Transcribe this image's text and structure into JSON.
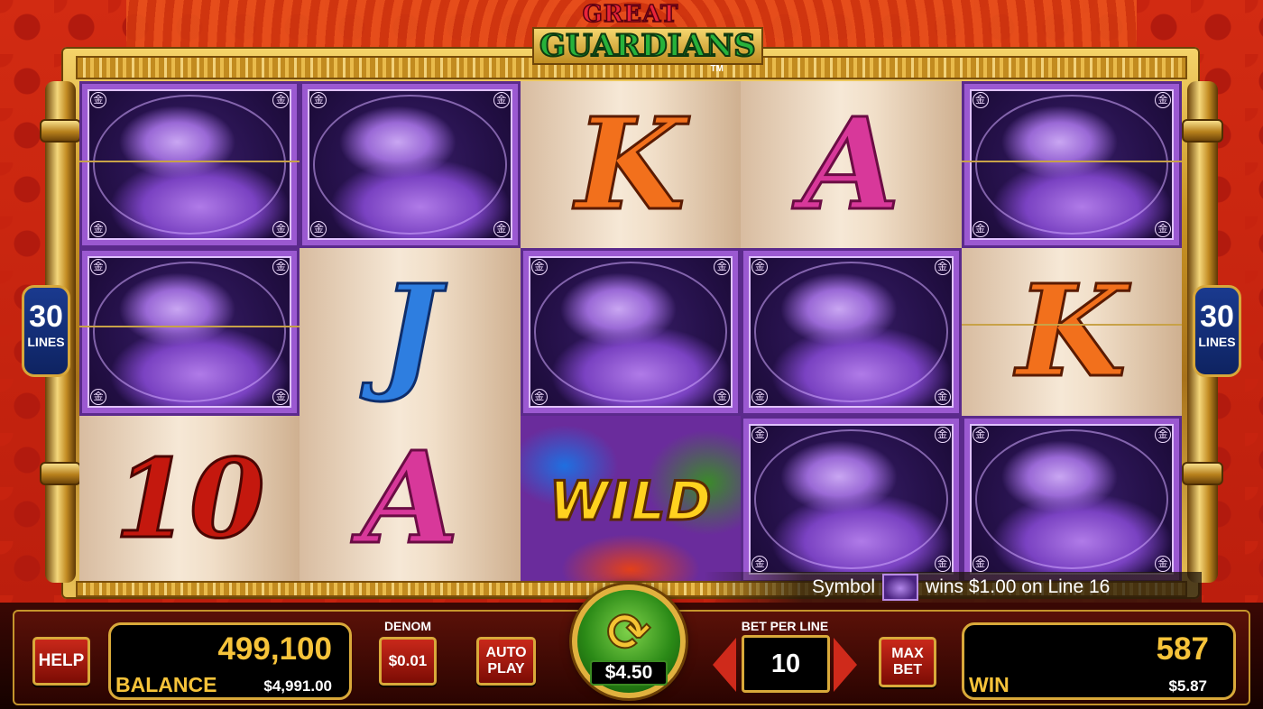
{
  "logo": {
    "line1": "GREAT",
    "line2": "GUARDIANS",
    "tm": "TM"
  },
  "lines": {
    "count": "30",
    "label": "LINES"
  },
  "reels": [
    [
      "tiger",
      "tiger",
      "ten"
    ],
    [
      "tiger",
      "J",
      "A"
    ],
    [
      "K",
      "tiger",
      "WILD"
    ],
    [
      "A",
      "tiger",
      "tiger"
    ],
    [
      "tiger",
      "K",
      "tiger"
    ]
  ],
  "symbols": {
    "K": "K",
    "A": "A",
    "J": "J",
    "ten": "10",
    "WILD": "WILD",
    "tiger_corner": "金"
  },
  "win_message": {
    "prefix": "Symbol",
    "suffix": "wins $1.00 on Line 16"
  },
  "controls": {
    "help": "HELP",
    "balance_credits": "499,100",
    "balance_label": "BALANCE",
    "balance_cash": "$4,991.00",
    "denom_label": "DENOM",
    "denom_value": "$0.01",
    "auto_play": "AUTO PLAY",
    "spin_bet": "$4.50",
    "spin_icon": "refresh-icon",
    "bet_per_line_label": "BET PER LINE",
    "bet_per_line_value": "10",
    "max_bet": "MAX BET",
    "win_credits": "587",
    "win_label": "WIN",
    "win_cash": "$5.87"
  },
  "colors": {
    "frame_gold": "#c99424",
    "background_red": "#c7230f",
    "tiger_purple": "#9b59d1",
    "spin_green": "#2b8a17",
    "amount_gold": "#f6c33a"
  }
}
